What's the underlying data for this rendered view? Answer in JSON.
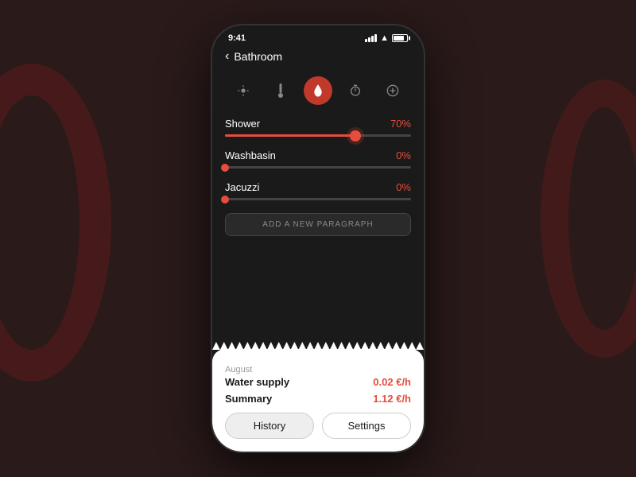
{
  "background": {
    "color": "#2a1a1a"
  },
  "statusBar": {
    "time": "9:41"
  },
  "nav": {
    "backLabel": "Bathroom"
  },
  "tabs": [
    {
      "icon": "💡",
      "label": "light",
      "active": false
    },
    {
      "icon": "🌡",
      "label": "temperature",
      "active": false
    },
    {
      "icon": "💧",
      "label": "water",
      "active": true
    },
    {
      "icon": "⏱",
      "label": "timer",
      "active": false
    },
    {
      "icon": "➕",
      "label": "add",
      "active": false
    }
  ],
  "controls": [
    {
      "label": "Shower",
      "value": "70%",
      "percent": 70
    },
    {
      "label": "Washbasin",
      "value": "0%",
      "percent": 0
    },
    {
      "label": "Jacuzzi",
      "value": "0%",
      "percent": 0
    }
  ],
  "addButton": {
    "label": "ADD A NEW PARAGRAPH"
  },
  "receipt": {
    "month": "August",
    "rows": [
      {
        "label": "Water supply",
        "value": "0.02 €/h"
      },
      {
        "label": "Summary",
        "value": "1.12 €/h"
      }
    ],
    "buttons": [
      {
        "label": "History"
      },
      {
        "label": "Settings"
      }
    ]
  }
}
